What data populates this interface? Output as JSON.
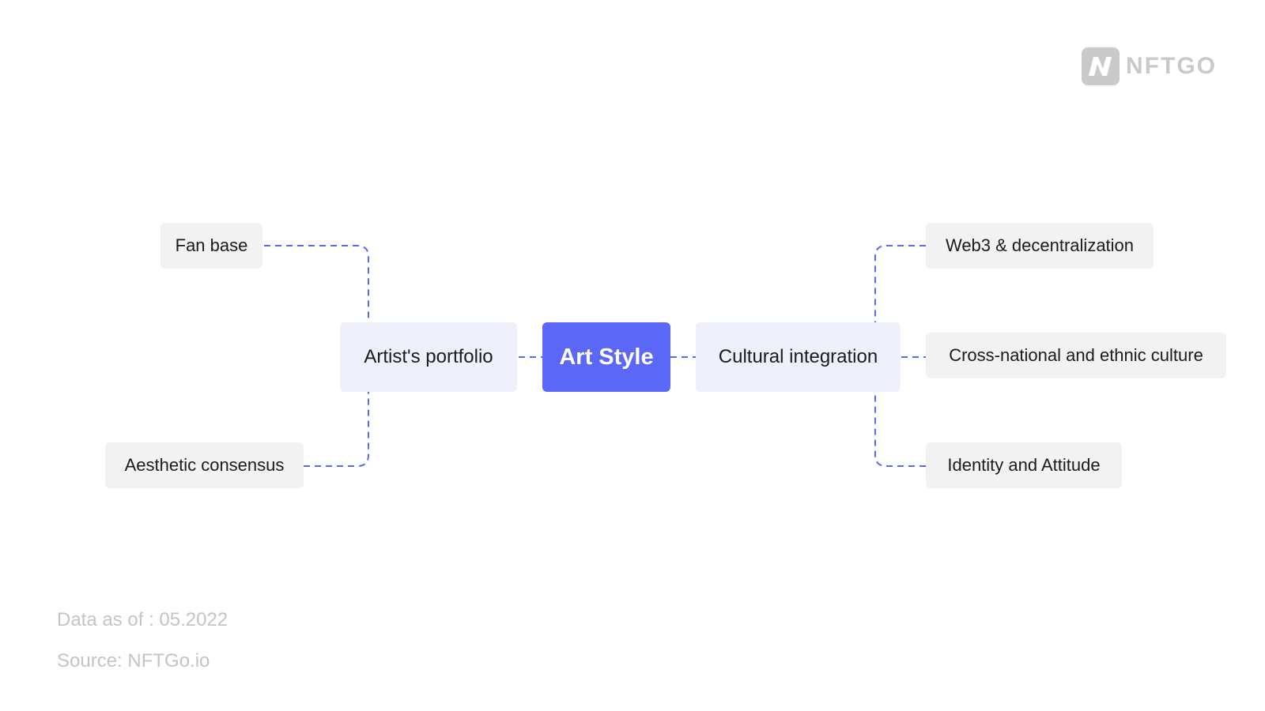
{
  "logo": {
    "text": "NFTGO",
    "icon": "nftgo-logo-icon",
    "color": "#c9c9c9"
  },
  "root": {
    "label": "Art Style",
    "color": "#5a67f7"
  },
  "branches": [
    {
      "label": "Artist's portfolio",
      "children": [
        "Fan base",
        "Aesthetic consensus"
      ]
    },
    {
      "label": "Cultural integration",
      "children": [
        "Web3 & decentralization",
        "Cross-national and ethnic culture",
        "Identity and Attitude"
      ]
    }
  ],
  "footer": {
    "data_as_of": "Data as of : 05.2022",
    "source": "Source: NFTGo.io"
  },
  "connector_color": "#5a67f7"
}
